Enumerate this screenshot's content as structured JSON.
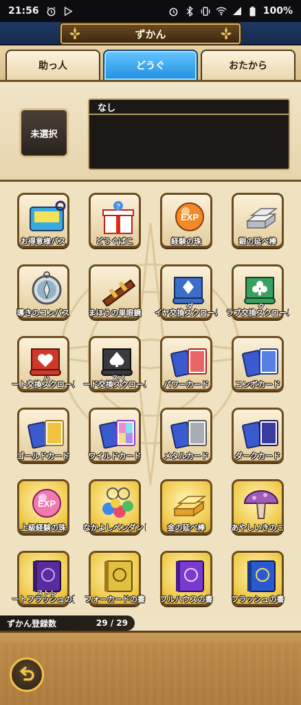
{
  "status_bar": {
    "time": "21:56",
    "battery": "100%"
  },
  "header": {
    "title": "ずかん"
  },
  "tabs": [
    {
      "label": "助っ人",
      "active": false
    },
    {
      "label": "どうぐ",
      "active": true
    },
    {
      "label": "おたから",
      "active": false
    }
  ],
  "selection": {
    "button_label": "未選択",
    "item_name": "なし"
  },
  "items": [
    {
      "label": "お得意様パス",
      "icon": "pass-icon"
    },
    {
      "label": "どうぐばこ",
      "icon": "gift-box-icon"
    },
    {
      "label": "経験の珠",
      "icon": "exp-orb-icon"
    },
    {
      "label": "銀の延べ棒",
      "icon": "silver-bar-icon"
    },
    {
      "label": "導きのコンパス",
      "icon": "compass-icon"
    },
    {
      "label": "まほうの単眼鏡",
      "icon": "telescope-icon"
    },
    {
      "label": "イヤ交換スクロール",
      "sublabel": "ダ",
      "icon": "diamond-scroll-icon"
    },
    {
      "label": "ラブ交換スクロール",
      "sublabel": "ク",
      "icon": "club-scroll-icon"
    },
    {
      "label": "ート交換スクロール",
      "sublabel": "ハ",
      "icon": "heart-scroll-icon"
    },
    {
      "label": "ード交換スクロール",
      "sublabel": "スペ",
      "icon": "spade-scroll-icon"
    },
    {
      "label": "パワーカード",
      "icon": "power-card-icon"
    },
    {
      "label": "コンボカード",
      "icon": "combo-card-icon"
    },
    {
      "label": "ゴールドカード",
      "icon": "gold-card-icon"
    },
    {
      "label": "ワイルドカード",
      "icon": "wild-card-icon"
    },
    {
      "label": "メタルカード",
      "icon": "metal-card-icon"
    },
    {
      "label": "ダークカード",
      "icon": "dark-card-icon"
    },
    {
      "label": "上級経験の珠",
      "icon": "high-exp-orb-icon"
    },
    {
      "label": "なかよしペンダント",
      "icon": "pendant-icon"
    },
    {
      "label": "金の延べ棒",
      "icon": "gold-bar-icon"
    },
    {
      "label": "あやしいきのこ",
      "icon": "mushroom-icon"
    },
    {
      "label": "ートフラッシュの書",
      "sublabel": "ストレ",
      "icon": "straight-flush-book-icon"
    },
    {
      "label": "フォーカードの書",
      "icon": "four-card-book-icon"
    },
    {
      "label": "フルハウスの書",
      "icon": "full-house-book-icon"
    },
    {
      "label": "フラッシュの書",
      "icon": "flush-book-icon"
    }
  ],
  "registration": {
    "label": "ずかん登録数",
    "count": "29 / 29"
  }
}
